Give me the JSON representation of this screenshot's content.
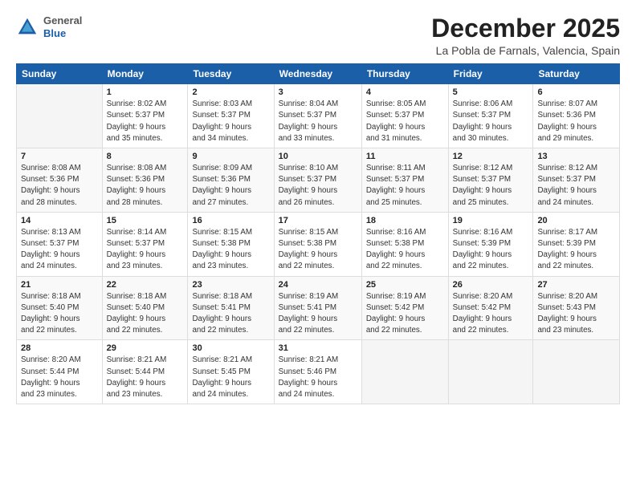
{
  "header": {
    "logo": {
      "general": "General",
      "blue": "Blue"
    },
    "title": "December 2025",
    "subtitle": "La Pobla de Farnals, Valencia, Spain"
  },
  "weekdays": [
    "Sunday",
    "Monday",
    "Tuesday",
    "Wednesday",
    "Thursday",
    "Friday",
    "Saturday"
  ],
  "weeks": [
    [
      {
        "day": "",
        "info": ""
      },
      {
        "day": "1",
        "info": "Sunrise: 8:02 AM\nSunset: 5:37 PM\nDaylight: 9 hours\nand 35 minutes."
      },
      {
        "day": "2",
        "info": "Sunrise: 8:03 AM\nSunset: 5:37 PM\nDaylight: 9 hours\nand 34 minutes."
      },
      {
        "day": "3",
        "info": "Sunrise: 8:04 AM\nSunset: 5:37 PM\nDaylight: 9 hours\nand 33 minutes."
      },
      {
        "day": "4",
        "info": "Sunrise: 8:05 AM\nSunset: 5:37 PM\nDaylight: 9 hours\nand 31 minutes."
      },
      {
        "day": "5",
        "info": "Sunrise: 8:06 AM\nSunset: 5:37 PM\nDaylight: 9 hours\nand 30 minutes."
      },
      {
        "day": "6",
        "info": "Sunrise: 8:07 AM\nSunset: 5:36 PM\nDaylight: 9 hours\nand 29 minutes."
      }
    ],
    [
      {
        "day": "7",
        "info": "Sunrise: 8:08 AM\nSunset: 5:36 PM\nDaylight: 9 hours\nand 28 minutes."
      },
      {
        "day": "8",
        "info": "Sunrise: 8:08 AM\nSunset: 5:36 PM\nDaylight: 9 hours\nand 28 minutes."
      },
      {
        "day": "9",
        "info": "Sunrise: 8:09 AM\nSunset: 5:36 PM\nDaylight: 9 hours\nand 27 minutes."
      },
      {
        "day": "10",
        "info": "Sunrise: 8:10 AM\nSunset: 5:37 PM\nDaylight: 9 hours\nand 26 minutes."
      },
      {
        "day": "11",
        "info": "Sunrise: 8:11 AM\nSunset: 5:37 PM\nDaylight: 9 hours\nand 25 minutes."
      },
      {
        "day": "12",
        "info": "Sunrise: 8:12 AM\nSunset: 5:37 PM\nDaylight: 9 hours\nand 25 minutes."
      },
      {
        "day": "13",
        "info": "Sunrise: 8:12 AM\nSunset: 5:37 PM\nDaylight: 9 hours\nand 24 minutes."
      }
    ],
    [
      {
        "day": "14",
        "info": "Sunrise: 8:13 AM\nSunset: 5:37 PM\nDaylight: 9 hours\nand 24 minutes."
      },
      {
        "day": "15",
        "info": "Sunrise: 8:14 AM\nSunset: 5:37 PM\nDaylight: 9 hours\nand 23 minutes."
      },
      {
        "day": "16",
        "info": "Sunrise: 8:15 AM\nSunset: 5:38 PM\nDaylight: 9 hours\nand 23 minutes."
      },
      {
        "day": "17",
        "info": "Sunrise: 8:15 AM\nSunset: 5:38 PM\nDaylight: 9 hours\nand 22 minutes."
      },
      {
        "day": "18",
        "info": "Sunrise: 8:16 AM\nSunset: 5:38 PM\nDaylight: 9 hours\nand 22 minutes."
      },
      {
        "day": "19",
        "info": "Sunrise: 8:16 AM\nSunset: 5:39 PM\nDaylight: 9 hours\nand 22 minutes."
      },
      {
        "day": "20",
        "info": "Sunrise: 8:17 AM\nSunset: 5:39 PM\nDaylight: 9 hours\nand 22 minutes."
      }
    ],
    [
      {
        "day": "21",
        "info": "Sunrise: 8:18 AM\nSunset: 5:40 PM\nDaylight: 9 hours\nand 22 minutes."
      },
      {
        "day": "22",
        "info": "Sunrise: 8:18 AM\nSunset: 5:40 PM\nDaylight: 9 hours\nand 22 minutes."
      },
      {
        "day": "23",
        "info": "Sunrise: 8:18 AM\nSunset: 5:41 PM\nDaylight: 9 hours\nand 22 minutes."
      },
      {
        "day": "24",
        "info": "Sunrise: 8:19 AM\nSunset: 5:41 PM\nDaylight: 9 hours\nand 22 minutes."
      },
      {
        "day": "25",
        "info": "Sunrise: 8:19 AM\nSunset: 5:42 PM\nDaylight: 9 hours\nand 22 minutes."
      },
      {
        "day": "26",
        "info": "Sunrise: 8:20 AM\nSunset: 5:42 PM\nDaylight: 9 hours\nand 22 minutes."
      },
      {
        "day": "27",
        "info": "Sunrise: 8:20 AM\nSunset: 5:43 PM\nDaylight: 9 hours\nand 23 minutes."
      }
    ],
    [
      {
        "day": "28",
        "info": "Sunrise: 8:20 AM\nSunset: 5:44 PM\nDaylight: 9 hours\nand 23 minutes."
      },
      {
        "day": "29",
        "info": "Sunrise: 8:21 AM\nSunset: 5:44 PM\nDaylight: 9 hours\nand 23 minutes."
      },
      {
        "day": "30",
        "info": "Sunrise: 8:21 AM\nSunset: 5:45 PM\nDaylight: 9 hours\nand 24 minutes."
      },
      {
        "day": "31",
        "info": "Sunrise: 8:21 AM\nSunset: 5:46 PM\nDaylight: 9 hours\nand 24 minutes."
      },
      {
        "day": "",
        "info": ""
      },
      {
        "day": "",
        "info": ""
      },
      {
        "day": "",
        "info": ""
      }
    ]
  ]
}
